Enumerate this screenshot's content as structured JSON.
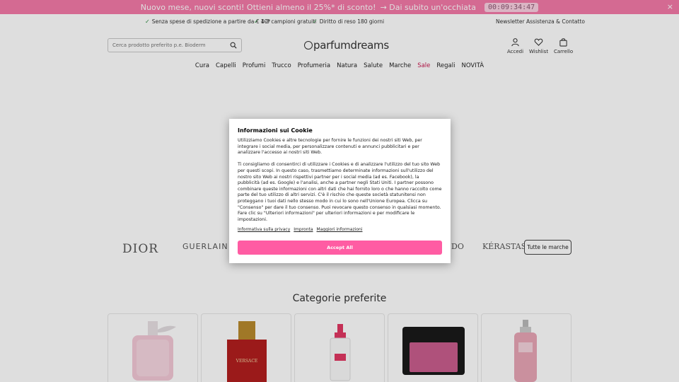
{
  "promo": {
    "text": "Nuovo mese, nuovi sconti! Ottieni almeno il 25%* di sconto!",
    "cta": "→ Dai subito un'occhiata",
    "timer": "00:09:34:47",
    "close": "×"
  },
  "usp": {
    "items": [
      "Senza spese di spedizione a partire da € 40*",
      "1-3 campioni gratuiti",
      "Diritto di reso 180 giorni"
    ],
    "newsletter": "Newsletter",
    "support": "Assistenza & Contatto"
  },
  "header": {
    "search_placeholder": "Cerca prodotto preferito p.e. Bioderm",
    "logo_text": "parfumdreams",
    "account": "Accedi",
    "wishlist": "Wishlist",
    "cart": "Carrello"
  },
  "nav": [
    "Cura",
    "Capelli",
    "Profumi",
    "Trucco",
    "Profumeria",
    "Natura",
    "Salute",
    "Marche",
    "Sale",
    "Regali",
    "NOVITÀ"
  ],
  "brands": {
    "list": [
      "DIOR",
      "GUERLAIN",
      "DO",
      "KÉRASTASE"
    ],
    "all_button": "Tutte le marche"
  },
  "categories": {
    "title": "Categorie preferite"
  },
  "cookie": {
    "title": "Informazioni sui Cookie",
    "para1": "Utilizziamo Cookies e altre tecnologie per fornire le funzioni dei nostri siti Web, per integrare i social media, per personalizzare contenuti e annunci pubblicitari e per analizzare l'accesso ai nostri siti Web.",
    "para2": "Ti consigliamo di consentirci di utilizzare i Cookies e di analizzare l'utilizzo del tuo sito Web per questi scopi. In questo caso, trasmettiamo determinate informazioni sull'utilizzo del nostro sito Web ai nostri rispettivi partner per i social media (ad es. Facebook), la pubblicità (ad es. Google) e l'analisi, anche a partner negli Stati Uniti. I partner possono combinare queste informazioni con altri dati che hai fornito loro o che hanno raccolto come parte del tuo utilizzo di altri servizi. C'è il rischio che queste società statunitensi non proteggano i tuoi dati nello stesso modo in cui lo sono nell'Unione Europea. Clicca su \"Consenso\" per dare il tuo consenso. Puoi revocare questo consenso in qualsiasi momento. Fare clic su \"Ulteriori informazioni\" per ulteriori informazioni e per modificare le impostazioni.",
    "links": [
      "Informativa sulla privacy",
      "Impronta",
      "Maggiori informazioni"
    ],
    "accept": "Accept All"
  },
  "colors": {
    "promo_bg": "#f47aa8",
    "accept_bg": "#ff5ca3",
    "sale": "#c8174e"
  }
}
